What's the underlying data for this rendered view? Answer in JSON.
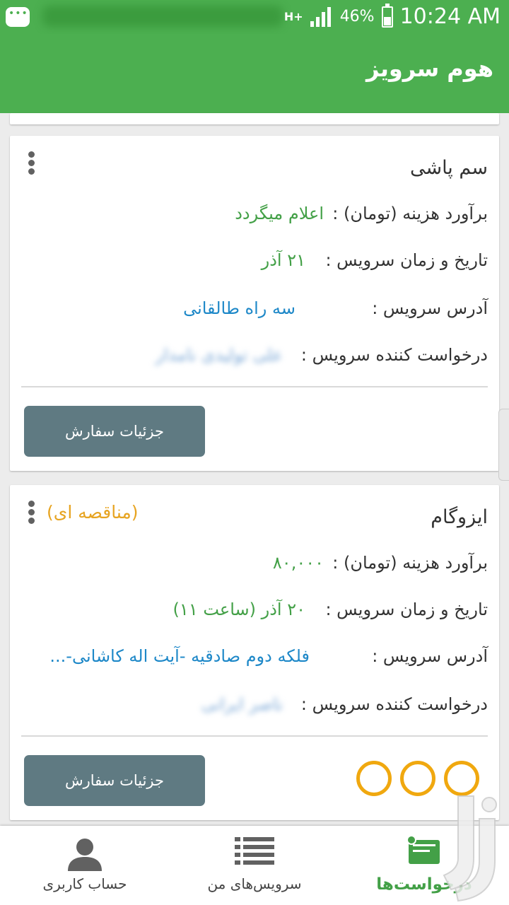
{
  "status_bar": {
    "network": "H+",
    "battery_percent": "46%",
    "time": "10:24 AM"
  },
  "app_bar": {
    "title": "هوم سرویز"
  },
  "cards": [
    {
      "service_name": "سم پاشی",
      "tender_label": "",
      "cost_label": "برآورد هزینه (تومان) :",
      "cost_value": "اعلام میگردد",
      "date_label": "تاریخ و زمان سرویس :",
      "date_value": "۲۱ آذر",
      "address_label": "آدرس سرویس :",
      "address_value": "سه راه طالقانی",
      "requester_label": "درخواست کننده سرویس :",
      "requester_value": "علی تولیدی نامدار",
      "button_label": "جزئیات سفارش"
    },
    {
      "service_name": "ایزوگام",
      "tender_label": "(مناقصه ای)",
      "cost_label": "برآورد هزینه (تومان) :",
      "cost_value": "۸۰,۰۰۰",
      "date_label": "تاریخ و زمان سرویس :",
      "date_value": "۲۰ آذر (ساعت ۱۱)",
      "address_label": "آدرس سرویس :",
      "address_value": "فلکه دوم صادقیه -آیت اله کاشانی-...",
      "requester_label": "درخواست کننده سرویس :",
      "requester_value": "ناصر ایرانی",
      "button_label": "جزئیات سفارش",
      "rating_filled": 0,
      "rating_max": 3
    }
  ],
  "bottom_nav": [
    {
      "label": "درخواست‌ها",
      "icon": "requests-icon",
      "active": true
    },
    {
      "label": "سرویس‌های من",
      "icon": "list-icon",
      "active": false
    },
    {
      "label": "حساب کاربری",
      "icon": "person-icon",
      "active": false
    }
  ],
  "colors": {
    "primary": "#4caf50",
    "button": "#5f7a82",
    "accent_orange": "#f0a80f",
    "value_green": "#43a047",
    "value_blue": "#1e88c8"
  }
}
